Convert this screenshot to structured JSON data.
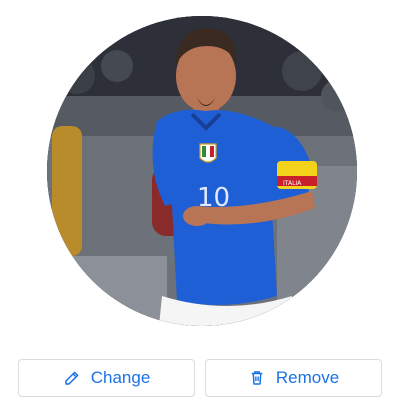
{
  "profile": {
    "photo_icon": "profile-photo",
    "jersey_number": "10",
    "armband_text": "ITALIA"
  },
  "actions": {
    "change": {
      "label": "Change",
      "icon": "pencil-icon"
    },
    "remove": {
      "label": "Remove",
      "icon": "trash-icon"
    }
  },
  "colors": {
    "accent": "#1a73e8",
    "border": "#dadce0",
    "jersey": "#1f5fd6"
  }
}
